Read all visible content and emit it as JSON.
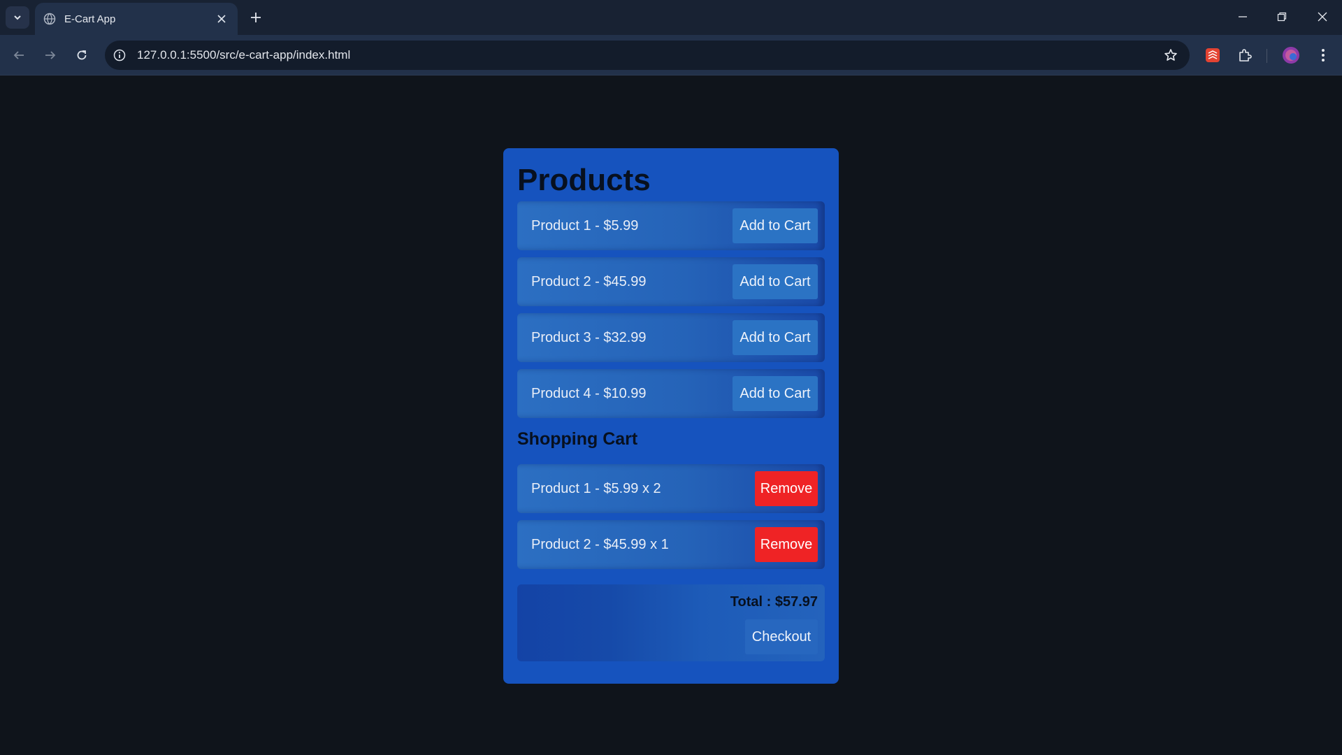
{
  "browser": {
    "tab_title": "E-Cart App",
    "url": "127.0.0.1:5500/src/e-cart-app/index.html"
  },
  "icons": {
    "tab_search": "chevron-down-icon",
    "favicon": "globe-icon",
    "tab_close": "close-icon",
    "new_tab": "plus-icon",
    "back": "arrow-left-icon",
    "forward": "arrow-right-icon",
    "reload": "reload-icon",
    "site_info": "info-icon",
    "bookmark": "star-icon",
    "extension_1": "todoist-icon",
    "extensions": "puzzle-icon",
    "profile": "avatar",
    "menu": "kebab-menu-icon"
  },
  "page": {
    "products_heading": "Products",
    "products": [
      {
        "label": "Product 1 - $5.99",
        "button": "Add to Cart"
      },
      {
        "label": "Product 2 - $45.99",
        "button": "Add to Cart"
      },
      {
        "label": "Product 3 - $32.99",
        "button": "Add to Cart"
      },
      {
        "label": "Product 4 - $10.99",
        "button": "Add to Cart"
      }
    ],
    "cart_heading": "Shopping Cart",
    "cart_items": [
      {
        "label": "Product 1 - $5.99 x 2",
        "button": "Remove"
      },
      {
        "label": "Product 2 - $45.99 x 1",
        "button": "Remove"
      }
    ],
    "total": "Total : $57.97",
    "checkout_label": "Checkout"
  },
  "colors": {
    "page_bg": "#0f141b",
    "card_bg": "#1653be",
    "add_button": "#2b73c4",
    "remove_button": "#ef2325",
    "heading_text": "#07101f"
  }
}
